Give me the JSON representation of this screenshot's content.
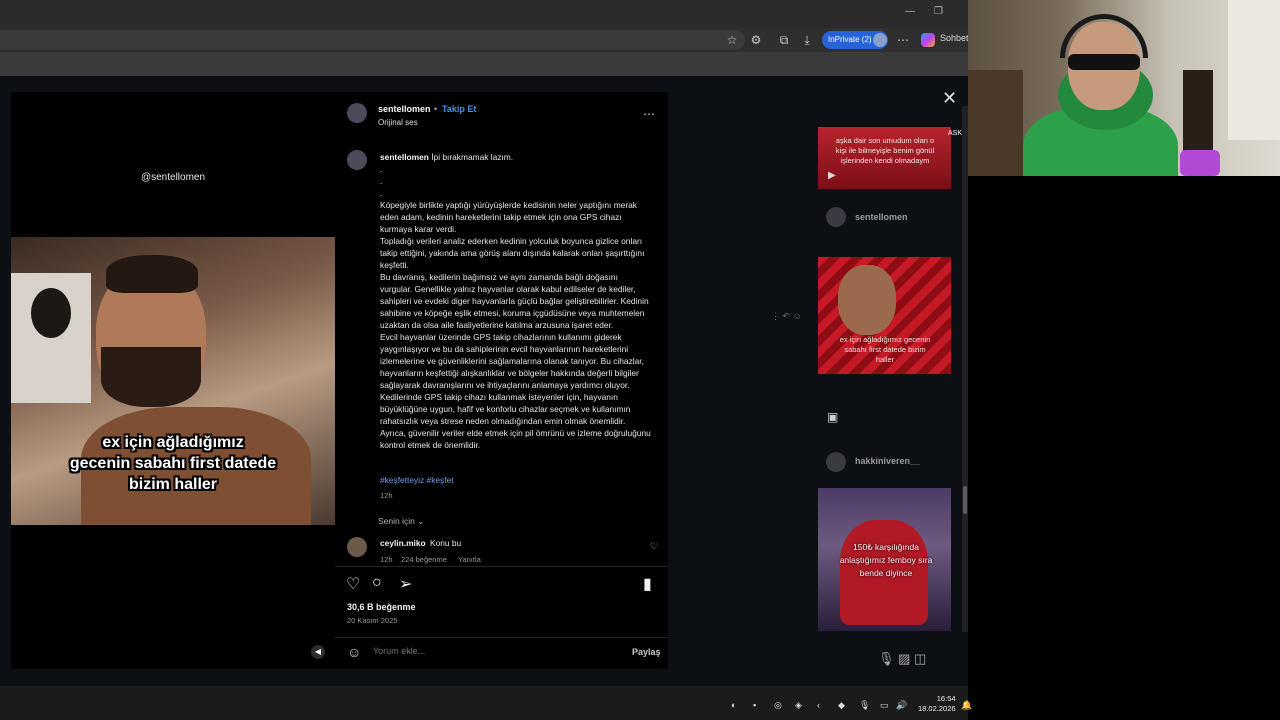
{
  "browser": {
    "inprivate_label": "InPrivate (2)",
    "copilot_label": "Sohbet",
    "icons": [
      "star-icon",
      "extensions-icon",
      "collections-icon",
      "download-icon",
      "more-icon"
    ]
  },
  "post": {
    "watermark": "@sentellomen",
    "video_caption": [
      "ex için ağladığımız",
      "gecenin sabahı first datede",
      "bizim haller"
    ],
    "username": "sentellomen",
    "follow_label": "Takip Et",
    "audio": "Orijinal ses",
    "caption_first": "İpi bırakmamak lazım.",
    "caption_lines": [
      ".",
      ".",
      ".",
      "Köpegiyle birlikte yaptığı yürüyüşlerde kedisinin neler yaptığını merak eden adam, kedinin hareketlerini takip etmek için ona GPS cihazı kurmaya karar verdi.",
      "Topladığı verileri analiz ederken kedinin yolculuk boyunca gizlice onları takip ettiğini, yakında ama görüş alanı dışında kalarak onları şaşırttığını keşfetti.",
      "Bu davranış, kedilerin bağımsız ve aynı zamanda bağlı doğasını vurgular. Genellikle yalnız hayvanlar olarak kabul edilseler de kediler, sahipleri ve evdeki diger hayvanlarla güçlü bağlar geliştirebilirler. Kedinin sahibine ve köpeğe eşlik etmesi, koruma içgüdüsüne veya muhtemelen uzaktan da olsa aile faaliyetlerine katılma arzusuna işaret eder.",
      "Evcil hayvanlar üzerinde GPS takip cihazlarının kullanımı giderek yaygınlaşıyor ve bu da sahiplerinin evcil hayvanlarının hareketlerini izlemelerine ve güvenliklerini sağlamalarına olanak tanıyor. Bu cihazlar, hayvanların keşfettiği alışkanlıklar ve bölgeler hakkında değerli bilgiler sağlayarak davranışlarını ve ihtiyaçlarını anlamaya yardımcı oluyor.",
      "Kedilerinde GPS takip cihazı kullanmak isteyenler için, hayvanın büyüklüğüne uygun, hafif ve konforlu cihazlar seçmek ve kullanımın rahatsızlık veya strese neden olmadığından emin olmak önemlidir. Ayrıca, güvenilir veriler elde etmek için pil ömrünü ve izleme doğruluğunu kontrol etmek de önemlidir."
    ],
    "hashtags": "#keşfetteyiz #keşfet",
    "caption_time": "12h",
    "for_you": "Senin için",
    "comment": {
      "username": "ceylin.miko",
      "text": "Konu bu",
      "time": "12h",
      "likes": "224 beğenme",
      "reply": "Yanıtla"
    },
    "like_count": "30,6 B beğenme",
    "date": "20 Kasım 2025",
    "comment_placeholder": "Yorum ekle...",
    "share_label": "Paylaş"
  },
  "sidebar": {
    "thumb1_text": "aşka dair son umudum olan o kişi ile bilmeyişle benim gönül işlerinden kendi olmadaym",
    "thumb1_badge": "ASKI SINE",
    "row1_name": "sentellomen",
    "thumb2_text": "ex için ağladığımız gecenin sabahı first datede bizim haller",
    "row2_name": "hakkiniveren__",
    "thumb3_text": "150₺ karşılığında anlaştığımız femboy sıra bende diyince"
  },
  "taskbar": {
    "time": "16:54",
    "date": "18.02.2026"
  }
}
